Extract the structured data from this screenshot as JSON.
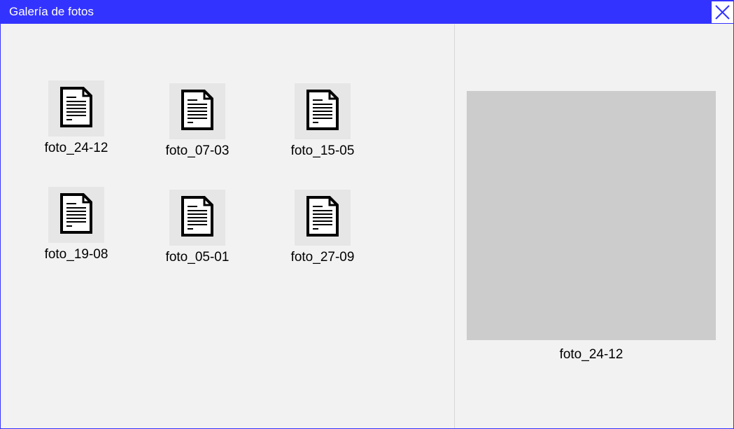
{
  "window": {
    "title": "Galería de fotos",
    "close_icon": "close-icon",
    "accent_color": "#3333ff"
  },
  "gallery": {
    "items": [
      {
        "label": "foto_24-12",
        "icon": "document-icon"
      },
      {
        "label": "foto_07-03",
        "icon": "document-icon"
      },
      {
        "label": "foto_15-05",
        "icon": "document-icon"
      },
      {
        "label": "foto_19-08",
        "icon": "document-icon"
      },
      {
        "label": "foto_05-01",
        "icon": "document-icon"
      },
      {
        "label": "foto_27-09",
        "icon": "document-icon"
      }
    ]
  },
  "preview": {
    "label": "foto_24-12"
  }
}
